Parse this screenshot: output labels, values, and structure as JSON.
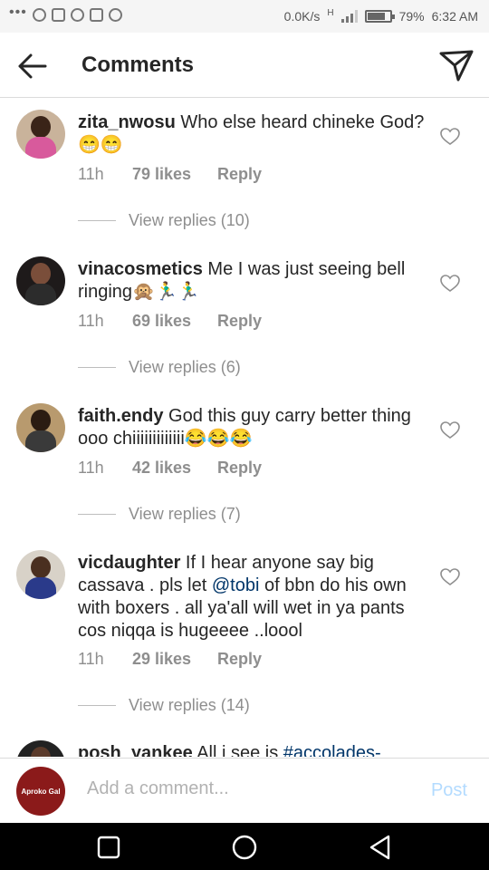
{
  "status_bar": {
    "dots": "•••",
    "network_speed": "0.0K/s",
    "network_type": "H",
    "battery_percent": "79%",
    "battery_level": 0.79,
    "time": "6:32 AM"
  },
  "header": {
    "title": "Comments"
  },
  "comments": [
    {
      "username": "zita_nwosu",
      "text": "Who else heard chineke God? 😁😁",
      "time": "11h",
      "likes": "79 likes",
      "reply_label": "Reply",
      "view_replies": "View replies (10)"
    },
    {
      "username": "vinacosmetics",
      "text": "Me I was just seeing bell ringing🙊🏃‍♂️🏃‍♂️",
      "time": "11h",
      "likes": "69 likes",
      "reply_label": "Reply",
      "view_replies": "View replies (6)"
    },
    {
      "username": "faith.endy",
      "text": "God this guy carry better thing ooo chiiiiiiiiiiiii😂😂😂",
      "time": "11h",
      "likes": "42 likes",
      "reply_label": "Reply",
      "view_replies": "View replies (7)"
    },
    {
      "username": "vicdaughter",
      "text_before": "If I hear anyone say big cassava . pls let ",
      "mention": "@tobi",
      "text_after": " of bbn do his own with boxers . all ya'all will wet in ya pants cos niqqa is hugeeee ..loool",
      "time": "11h",
      "likes": "29 likes",
      "reply_label": "Reply",
      "view_replies": "View replies (14)"
    },
    {
      "username": "posh_yankee",
      "text_before": "All i see is ",
      "hashtag": "#accolades-"
    }
  ],
  "composer": {
    "avatar_text": "Aproko Gal",
    "placeholder": "Add a comment...",
    "post_label": "Post"
  },
  "colors": {
    "post_disabled": "#b3dbff",
    "mention": "#003569",
    "secondary_text": "#8e8e8e"
  }
}
